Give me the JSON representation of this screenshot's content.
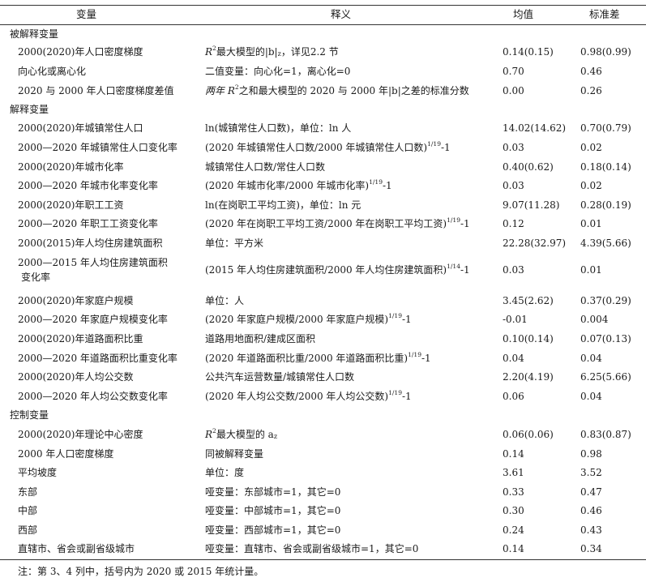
{
  "header": {
    "col1": "变量",
    "col2": "释义",
    "col3": "均值",
    "col4": "标准差"
  },
  "sections": {
    "dependent": "被解释变量",
    "explanatory": "解释变量",
    "control": "控制变量"
  },
  "rows": {
    "r1": {
      "name": "2000(2020)年人口密度梯度",
      "def_a": "R",
      "def_sup": "2",
      "def_b": "最大模型的|b|",
      "def_sub": "z",
      "def_c": "，详见2.2 节",
      "mean": "0.14(0.15)",
      "sd": "0.98(0.99)"
    },
    "r2": {
      "name": "向心化或离心化",
      "def": "二值变量：向心化=1，离心化=0",
      "mean": "0.70",
      "sd": "0.46"
    },
    "r3": {
      "name": "2020 与 2000 年人口密度梯度差值",
      "def_a": "两年 R",
      "def_sup": "2",
      "def_b": "之和最大模型的 2020 与 2000 年|b|之差的标准分数",
      "mean": "0.00",
      "sd": "0.26"
    },
    "r4": {
      "name": "2000(2020)年城镇常住人口",
      "def": "ln(城镇常住人口数)，单位：ln 人",
      "mean": "14.02(14.62)",
      "sd": "0.70(0.79)"
    },
    "r5": {
      "name": "2000—2020 年城镇常住人口变化率",
      "def_a": "(2020 年城镇常住人口数/2000 年城镇常住人口数)",
      "def_sup": "1/19",
      "def_b": "-1",
      "mean": "0.03",
      "sd": "0.02"
    },
    "r6": {
      "name": "2000(2020)年城市化率",
      "def": "城镇常住人口数/常住人口数",
      "mean": "0.40(0.62)",
      "sd": "0.18(0.14)"
    },
    "r7": {
      "name": "2000—2020 年城市化率变化率",
      "def_a": "(2020 年城市化率/2000 年城市化率)",
      "def_sup": "1/19",
      "def_b": "-1",
      "mean": "0.03",
      "sd": "0.02"
    },
    "r8": {
      "name": "2000(2020)年职工工资",
      "def": "ln(在岗职工平均工资)，单位：ln 元",
      "mean": "9.07(11.28)",
      "sd": "0.28(0.19)"
    },
    "r9": {
      "name": "2000—2020 年职工工资变化率",
      "def_a": "(2020 年在岗职工平均工资/2000 年在岗职工平均工资)",
      "def_sup": "1/19",
      "def_b": "-1",
      "mean": "0.12",
      "sd": "0.01"
    },
    "r10": {
      "name": "2000(2015)年人均住房建筑面积",
      "def": "单位：平方米",
      "mean": "22.28(32.97)",
      "sd": "4.39(5.66)"
    },
    "r11": {
      "name_l1": "2000—2015 年人均住房建筑面积",
      "name_l2": "变化率",
      "def_a": "(2015 年人均住房建筑面积/2000 年人均住房建筑面积)",
      "def_sup": "1/14",
      "def_b": "-1",
      "mean": "0.03",
      "sd": "0.01"
    },
    "r12": {
      "name": "2000(2020)年家庭户规模",
      "def": "单位：人",
      "mean": "3.45(2.62)",
      "sd": "0.37(0.29)"
    },
    "r13": {
      "name": "2000—2020 年家庭户规模变化率",
      "def_a": "(2020 年家庭户规模/2000 年家庭户规模)",
      "def_sup": "1/19",
      "def_b": "-1",
      "mean": "-0.01",
      "sd": "0.004"
    },
    "r14": {
      "name": "2000(2020)年道路面积比重",
      "def": "道路用地面积/建成区面积",
      "mean": "0.10(0.14)",
      "sd": "0.07(0.13)"
    },
    "r15": {
      "name": "2000—2020 年道路面积比重变化率",
      "def_a": "(2020 年道路面积比重/2000 年道路面积比重)",
      "def_sup": "1/19",
      "def_b": "-1",
      "mean": "0.04",
      "sd": "0.04"
    },
    "r16": {
      "name": "2000(2020)年人均公交数",
      "def": "公共汽车运营数量/城镇常住人口数",
      "mean": "2.20(4.19)",
      "sd": "6.25(5.66)"
    },
    "r17": {
      "name": "2000—2020 年人均公交数变化率",
      "def_a": "(2020 年人均公交数/2000 年人均公交数)",
      "def_sup": "1/19",
      "def_b": "-1",
      "mean": "0.06",
      "sd": "0.04"
    },
    "r18": {
      "name": "2000(2020)年理论中心密度",
      "def_a": "R",
      "def_sup": "2",
      "def_b": "最大模型的 a",
      "def_sub": "z",
      "mean": "0.06(0.06)",
      "sd": "0.83(0.87)"
    },
    "r19": {
      "name": "2000 年人口密度梯度",
      "def": "同被解释变量",
      "mean": "0.14",
      "sd": "0.98"
    },
    "r20": {
      "name": "平均坡度",
      "def": "单位：度",
      "mean": "3.61",
      "sd": "3.52"
    },
    "r21": {
      "name": "东部",
      "def": "哑变量：东部城市=1，其它=0",
      "mean": "0.33",
      "sd": "0.47"
    },
    "r22": {
      "name": "中部",
      "def": "哑变量：中部城市=1，其它=0",
      "mean": "0.30",
      "sd": "0.46"
    },
    "r23": {
      "name": "西部",
      "def": "哑变量：西部城市=1，其它=0",
      "mean": "0.24",
      "sd": "0.43"
    },
    "r24": {
      "name": "直辖市、省会或副省级城市",
      "def": "哑变量：直辖市、省会或副省级城市=1，其它=0",
      "mean": "0.14",
      "sd": "0.34"
    }
  },
  "note": "注：第 3、4 列中，括号内为 2020 或 2015 年统计量。"
}
